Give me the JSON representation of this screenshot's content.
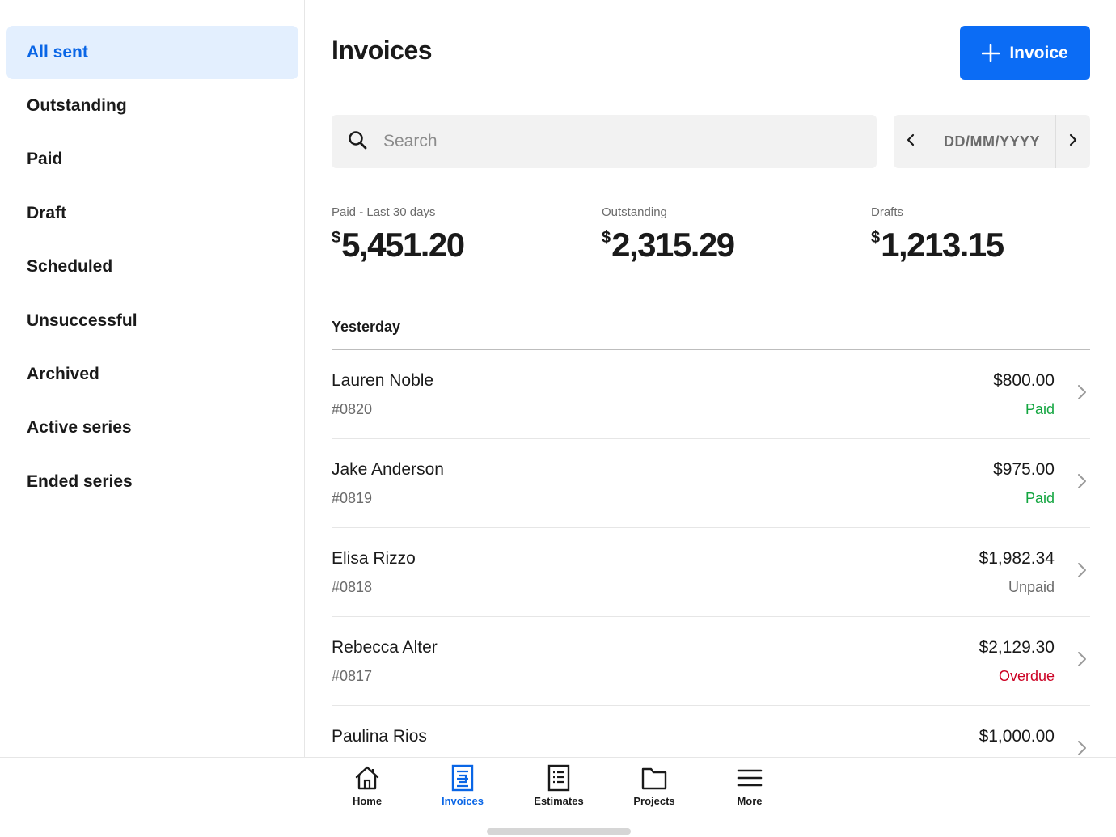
{
  "sidebar": {
    "items": [
      {
        "label": "All sent",
        "active": true
      },
      {
        "label": "Outstanding"
      },
      {
        "label": "Paid"
      },
      {
        "label": "Draft"
      },
      {
        "label": "Scheduled"
      },
      {
        "label": "Unsuccessful"
      },
      {
        "label": "Archived"
      },
      {
        "label": "Active series"
      },
      {
        "label": "Ended series"
      }
    ]
  },
  "header": {
    "title": "Invoices",
    "add_button_label": "Invoice",
    "add_button_icon": "plus-icon"
  },
  "search": {
    "placeholder": "Search",
    "value": "",
    "icon": "search-icon"
  },
  "date_filter": {
    "placeholder": "DD/MM/YYYY",
    "prev_icon": "chevron-left-icon",
    "next_icon": "chevron-right-icon"
  },
  "stats": [
    {
      "label": "Paid - Last 30 days",
      "currency": "$",
      "amount": "5,451.20"
    },
    {
      "label": "Outstanding",
      "currency": "$",
      "amount": "2,315.29"
    },
    {
      "label": "Drafts",
      "currency": "$",
      "amount": "1,213.15"
    }
  ],
  "list": {
    "section_title": "Yesterday",
    "rows": [
      {
        "name": "Lauren Noble",
        "number": "#0820",
        "amount": "$800.00",
        "status": "Paid",
        "status_color": "#12a53f"
      },
      {
        "name": "Jake Anderson",
        "number": "#0819",
        "amount": "$975.00",
        "status": "Paid",
        "status_color": "#12a53f"
      },
      {
        "name": "Elisa Rizzo",
        "number": "#0818",
        "amount": "$1,982.34",
        "status": "Unpaid",
        "status_color": "#6b6b6b"
      },
      {
        "name": "Rebecca Alter",
        "number": "#0817",
        "amount": "$2,129.30",
        "status": "Overdue",
        "status_color": "#cc0023"
      },
      {
        "name": "Paulina Rios",
        "number": "",
        "amount": "$1,000.00",
        "status": "",
        "status_color": "#6b6b6b"
      }
    ]
  },
  "bottom_nav": {
    "tabs": [
      {
        "label": "Home",
        "icon": "home-icon"
      },
      {
        "label": "Invoices",
        "icon": "invoice-icon",
        "active": true
      },
      {
        "label": "Estimates",
        "icon": "estimates-icon"
      },
      {
        "label": "Projects",
        "icon": "folder-icon"
      },
      {
        "label": "More",
        "icon": "menu-icon"
      }
    ]
  },
  "colors": {
    "accent": "#0b6cf5",
    "active_bg": "#e3effe",
    "paid": "#12a53f",
    "overdue": "#cc0023"
  }
}
